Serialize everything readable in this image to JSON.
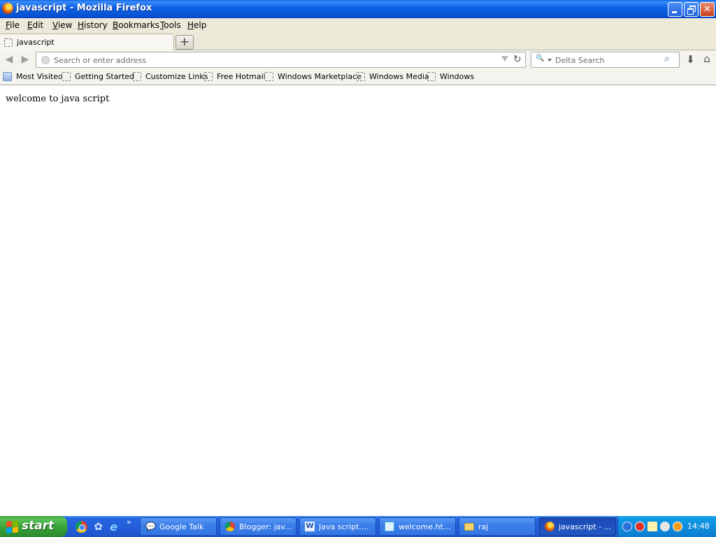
{
  "window": {
    "title": "javascript - Mozilla Firefox"
  },
  "menu": {
    "items": [
      "File",
      "Edit",
      "View",
      "History",
      "Bookmarks",
      "Tools",
      "Help"
    ]
  },
  "tabs": [
    {
      "title": "javascript",
      "active": true
    }
  ],
  "navbar": {
    "address_placeholder": "Search or enter address",
    "search_placeholder": "Delta Search"
  },
  "bookmarks": [
    "Most Visited",
    "Getting Started",
    "Customize Links",
    "Free Hotmail",
    "Windows Marketplace",
    "Windows Media",
    "Windows"
  ],
  "content": {
    "text": "welcome to java script"
  },
  "taskbar": {
    "start_label": "start",
    "quick_launch": [
      "chrome-icon",
      "messenger-icon",
      "ie-icon"
    ],
    "tasks": [
      {
        "label": "Google Talk",
        "icon": "chat-icon",
        "active": false
      },
      {
        "label": "Blogger: jav...",
        "icon": "chrome-icon",
        "active": false
      },
      {
        "label": "Java script....",
        "icon": "word-icon",
        "active": false
      },
      {
        "label": "welcome.ht...",
        "icon": "notepad-icon",
        "active": false
      },
      {
        "label": "raj",
        "icon": "folder-icon",
        "active": false
      },
      {
        "label": "javascript - ...",
        "icon": "firefox-icon",
        "active": true
      }
    ],
    "clock": "14:48"
  },
  "colors": {
    "titlebar": "#0a58d8",
    "taskbar": "#245edb",
    "start_green": "#37a137",
    "chrome_bg": "#ece9d8"
  }
}
